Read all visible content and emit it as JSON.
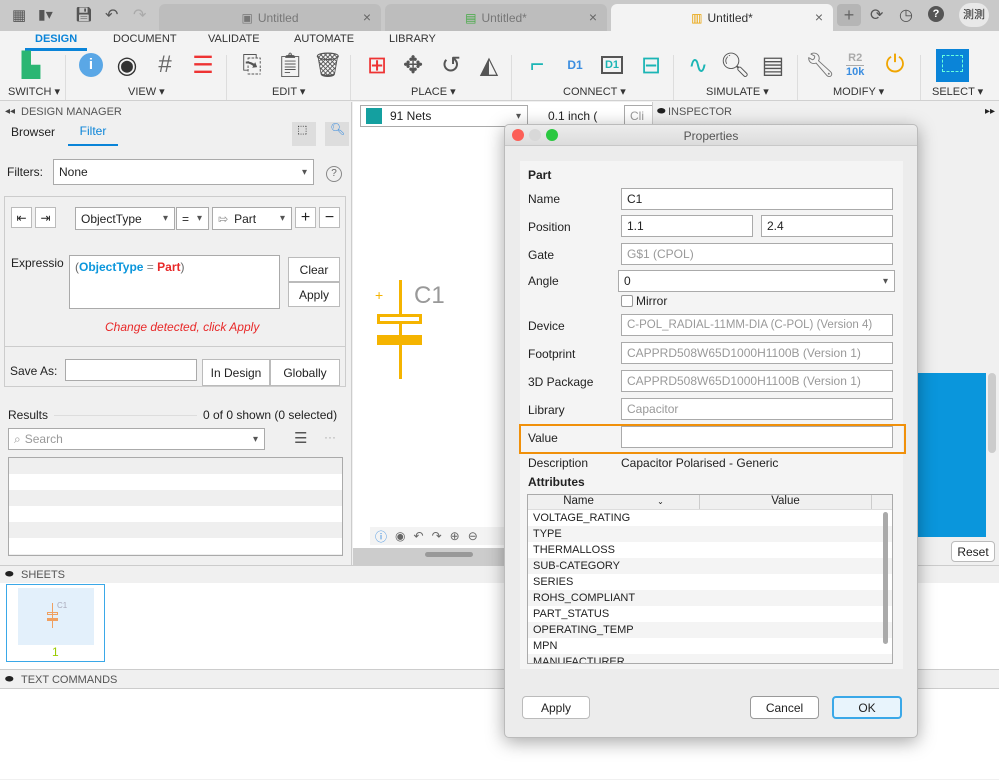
{
  "app_bar": {
    "icons": [
      "grid-icon",
      "file-icon",
      "save-icon",
      "undo-icon",
      "redo-icon"
    ],
    "tabs": [
      {
        "label": "Untitled",
        "close": "×"
      },
      {
        "label": "Untitled*",
        "close": "×"
      },
      {
        "label": "Untitled*",
        "close": "×",
        "active": true
      }
    ],
    "new_tab": "+",
    "user": "測測"
  },
  "ribbon": {
    "tabs": [
      "DESIGN",
      "DOCUMENT",
      "VALIDATE",
      "AUTOMATE",
      "LIBRARY"
    ],
    "active_tab": "DESIGN",
    "groups": [
      "SWITCH ▾",
      "VIEW ▾",
      "EDIT ▾",
      "PLACE ▾",
      "CONNECT ▾",
      "SIMULATE ▾",
      "MODIFY ▾",
      "SELECT ▾"
    ],
    "r2_label": "R2",
    "r2_value": "10k",
    "d1": "D1"
  },
  "design_manager": {
    "title": "DESIGN MANAGER",
    "tabs": [
      "Browser",
      "Filter"
    ],
    "active_tab": "Filter",
    "filters_label": "Filters:",
    "filters_value": "None",
    "help": "?",
    "condition": {
      "field": "ObjectType",
      "op": "=",
      "value": "Part",
      "add": "+",
      "remove": "−"
    },
    "expression_label": "Expressio",
    "expr_open": "(",
    "expr_field": "ObjectType",
    "expr_op": " = ",
    "expr_value": "Part",
    "expr_close": ")",
    "clear": "Clear",
    "apply": "Apply",
    "warning": "Change detected, click Apply",
    "save_as_label": "Save As:",
    "save_as_value": "",
    "in_design": "In Design",
    "globally": "Globally",
    "results_label": "Results",
    "results_count": "0 of 0 shown (0 selected)",
    "search_placeholder": "Search",
    "more": "···"
  },
  "canvas": {
    "nets": "91 Nets",
    "grid": "0.1 inch (",
    "cmd_placeholder": "Cli",
    "part_label": "C1",
    "plus": "+",
    "color_part": "#f5b400"
  },
  "inspector": {
    "title": "INSPECTOR",
    "reset": "Reset",
    "accent": "#0a96dc"
  },
  "sheets": {
    "title": "SHEETS",
    "items": [
      {
        "number": "1",
        "thumb_label": "C1"
      }
    ]
  },
  "text_commands": {
    "title": "TEXT COMMANDS"
  },
  "properties": {
    "title": "Properties",
    "section": "Part",
    "name_label": "Name",
    "name": "C1",
    "position_label": "Position",
    "pos_x": "1.1",
    "pos_y": "2.4",
    "gate_label": "Gate",
    "gate": "G$1 (CPOL)",
    "angle_label": "Angle",
    "angle": "0",
    "mirror_label": "Mirror",
    "mirror": false,
    "device_label": "Device",
    "device": "C-POL_RADIAL-11MM-DIA (C-POL) (Version 4)",
    "footprint_label": "Footprint",
    "footprint": "CAPPRD508W65D1000H1100B (Version 1)",
    "package_label": "3D Package",
    "package": "CAPPRD508W65D1000H1100B (Version 1)",
    "library_label": "Library",
    "library": "Capacitor",
    "value_label": "Value",
    "value": "",
    "description_label": "Description",
    "description": "Capacitor Polarised - Generic",
    "attributes_label": "Attributes",
    "attr_columns": [
      "Name",
      "Value"
    ],
    "attributes": [
      "VOLTAGE_RATING",
      "TYPE",
      "THERMALLOSS",
      "SUB-CATEGORY",
      "SERIES",
      "ROHS_COMPLIANT",
      "PART_STATUS",
      "OPERATING_TEMP",
      "MPN",
      "MANUFACTURER"
    ],
    "apply": "Apply",
    "cancel": "Cancel",
    "ok": "OK",
    "highlight": "#f0900a"
  }
}
